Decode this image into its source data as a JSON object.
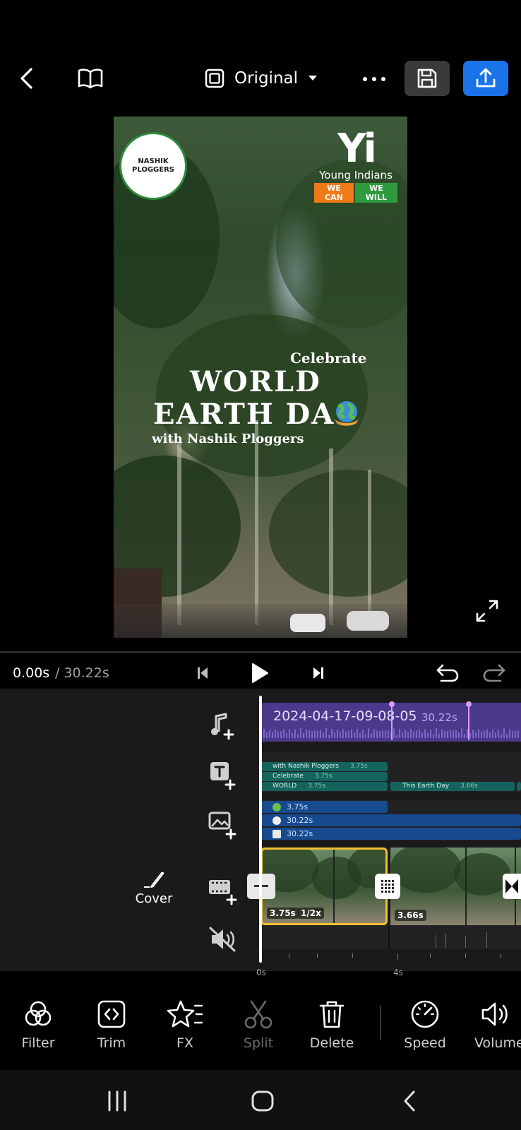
{
  "topbar": {
    "aspect_label": "Original"
  },
  "preview": {
    "logo_left_text": "NASHIK PLOGGERS",
    "logo_right_mark": "Yi",
    "logo_right_name": "Young Indians",
    "logo_right_tag1": "WE CAN",
    "logo_right_tag2": "WE WILL",
    "overlay_celebrate": "Celebrate",
    "overlay_world": "WORLD",
    "overlay_earth": "EARTH DA",
    "overlay_with": "with Nashik Ploggers"
  },
  "playback": {
    "current_time": "0.00s",
    "total_time": "/ 30.22s"
  },
  "timeline": {
    "audio": {
      "label": "2024-04-17-09-08-05",
      "duration": "30.22s"
    },
    "text_clips": [
      {
        "label": "with Nashik Ploggers",
        "duration": "3.75s"
      },
      {
        "label": "Celebrate",
        "duration": "3.75s"
      },
      {
        "label": "WORLD",
        "duration": "3.75s"
      },
      {
        "label": "This Earth Day",
        "duration": "3.66s"
      }
    ],
    "sticker_clips": [
      {
        "duration": "3.75s"
      },
      {
        "duration": "30.22s"
      },
      {
        "duration": "30.22s"
      }
    ],
    "video_clips": [
      {
        "duration": "3.75s",
        "speed": "1/2x"
      },
      {
        "duration": "3.66s"
      }
    ],
    "ruler": {
      "start": "0s",
      "mark": "4s"
    },
    "cover_label": "Cover"
  },
  "tools": [
    {
      "label": "Filter"
    },
    {
      "label": "Trim"
    },
    {
      "label": "FX"
    },
    {
      "label": "Split"
    },
    {
      "label": "Delete"
    },
    {
      "label": "Speed"
    },
    {
      "label": "Volume"
    }
  ],
  "colors": {
    "accent_blue": "#1a73e8",
    "clip_selected": "#f2c12e",
    "audio_track": "#4b3a8c",
    "text_track": "#14635c",
    "sticker_track": "#174a8f"
  }
}
